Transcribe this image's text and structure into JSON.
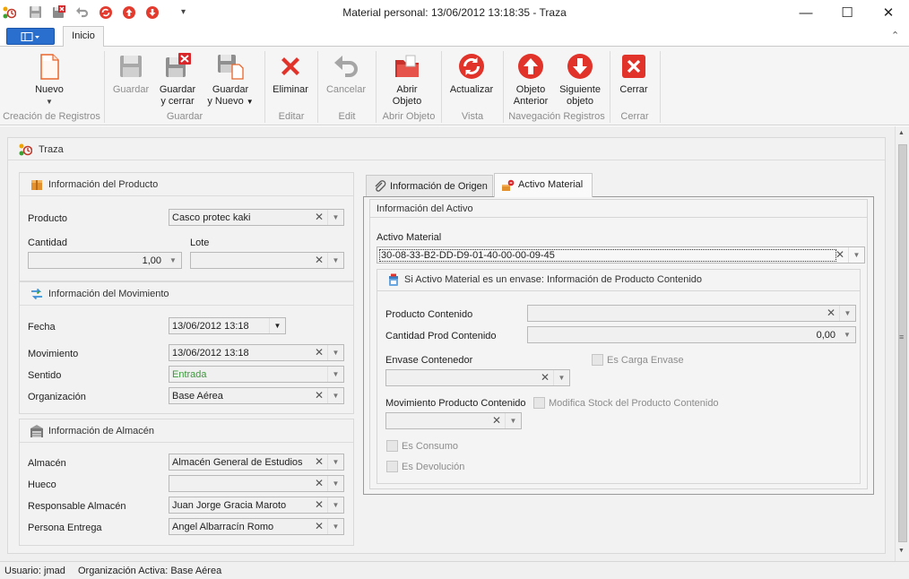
{
  "window": {
    "title": "Material personal: 13/06/2012 13:18:35 - Traza",
    "minimize_glyph": "—",
    "maximize_glyph": "☐",
    "close_glyph": "✕"
  },
  "quick_access": {
    "icons": [
      "traza-app-icon",
      "save-icon",
      "save-close-icon",
      "undo-icon",
      "refresh-icon",
      "up-arrow-icon",
      "down-arrow-icon",
      "customize-icon"
    ],
    "customize_glyph": "▾"
  },
  "ribbon": {
    "tab": "Inicio",
    "collapse_glyph": "⌃",
    "buttons": {
      "nuevo": "Nuevo",
      "guardar": "Guardar",
      "guardar_cerrar_1": "Guardar",
      "guardar_cerrar_2": "y cerrar",
      "guardar_nuevo_1": "Guardar",
      "guardar_nuevo_2": "y Nuevo",
      "eliminar": "Eliminar",
      "cancelar": "Cancelar",
      "abrir_1": "Abrir",
      "abrir_2": "Objeto",
      "actualizar": "Actualizar",
      "anterior_1": "Objeto",
      "anterior_2": "Anterior",
      "siguiente_1": "Siguiente",
      "siguiente_2": "objeto",
      "cerrar": "Cerrar"
    },
    "groups": {
      "creacion": "Creación de Registros",
      "guardar": "Guardar",
      "editar": "Editar",
      "edit": "Edit",
      "abrir": "Abrir Objeto",
      "vista": "Vista",
      "navegacion": "Navegación Registros",
      "cerrar": "Cerrar"
    },
    "colors": {
      "accent": "#2b6fce",
      "danger": "#e2332a"
    }
  },
  "main": {
    "header": "Traza",
    "producto_panel": {
      "title": "Información del Producto",
      "producto_label": "Producto",
      "producto_value": "Casco protec kaki",
      "cantidad_label": "Cantidad",
      "cantidad_value": "1,00",
      "lote_label": "Lote",
      "lote_value": ""
    },
    "movimiento_panel": {
      "title": "Información del Movimiento",
      "fecha_label": "Fecha",
      "fecha_value": "13/06/2012 13:18",
      "movimiento_label": "Movimiento",
      "movimiento_value": "13/06/2012 13:18",
      "sentido_label": "Sentido",
      "sentido_value": "Entrada",
      "organizacion_label": "Organización",
      "organizacion_value": "Base Aérea"
    },
    "almacen_panel": {
      "title": "Información de Almacén",
      "almacen_label": "Almacén",
      "almacen_value": "Almacén General de Estudios",
      "hueco_label": "Hueco",
      "hueco_value": "",
      "responsable_label": "Responsable Almacén",
      "responsable_value": "Juan Jorge Gracia Maroto",
      "persona_label": "Persona Entrega",
      "persona_value": "Angel Albarracín Romo"
    },
    "right_tabs": [
      "Información de Origen",
      "Activo Material"
    ],
    "activo": {
      "section_title": "Información del Activo",
      "activo_label": "Activo Material",
      "activo_value": "30-08-33-B2-DD-D9-01-40-00-00-09-45",
      "contenido_title": "Si Activo Material es un envase: Información de Producto Contenido",
      "producto_contenido_label": "Producto Contenido",
      "producto_contenido_value": "",
      "cantidad_prod_label": "Cantidad Prod Contenido",
      "cantidad_prod_value": "0,00",
      "envase_label": "Envase Contenedor",
      "envase_value": "",
      "es_carga_label": "Es Carga Envase",
      "movimiento_prod_label": "Movimiento Producto Contenido",
      "movimiento_prod_value": "",
      "modifica_stock_label": "Modifica Stock del Producto Contenido",
      "es_consumo_label": "Es Consumo",
      "es_devolucion_label": "Es Devolución"
    },
    "clear_glyph": "✕",
    "dropdown_glyph": "▼"
  },
  "scrollbar": {
    "up_glyph": "▲",
    "down_glyph": "▼",
    "grip_glyph": "≡"
  },
  "status": {
    "usuario": "Usuario: jmad",
    "organizacion": "Organización Activa: Base Aérea"
  }
}
